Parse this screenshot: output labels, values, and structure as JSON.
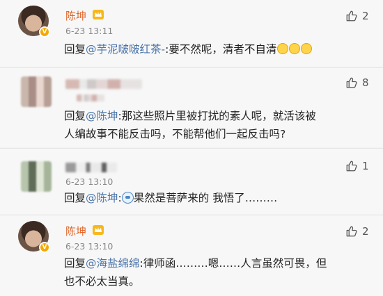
{
  "comments": [
    {
      "user": "陈坤",
      "time": "6-23 13:11",
      "likes": "2",
      "reply_prefix": "回复",
      "mention": "@芋泥啵啵红茶-",
      "text": ":要不然呢，清者不自清"
    },
    {
      "user": "",
      "time": "",
      "likes": "8",
      "reply_prefix": "回复",
      "mention": "@陈坤",
      "text_line1": ":那这些照片里被打扰的素人呢，就活该被",
      "text_line2": "人编故事不能反击吗，不能帮他们一起反击吗?"
    },
    {
      "user": "",
      "time": "6-23 13:10",
      "likes": "1",
      "reply_prefix": "回复",
      "mention": "@陈坤",
      "text": "果然是菩萨来的 我悟了………"
    },
    {
      "user": "陈坤",
      "time": "6-23 13:10",
      "likes": "2",
      "reply_prefix": "回复",
      "mention": "@海盐绵绵",
      "text_line1": ":律师函………嗯……人言虽然可畏，但",
      "text_line2": "也不必太当真。"
    }
  ],
  "icons": {
    "like": "thumbs-up-icon",
    "verified_badge": "v-badge",
    "crown": "crown-icon"
  },
  "colors": {
    "username": "#e0662a",
    "mention": "#4b74a8",
    "badge": "#f6a800"
  }
}
